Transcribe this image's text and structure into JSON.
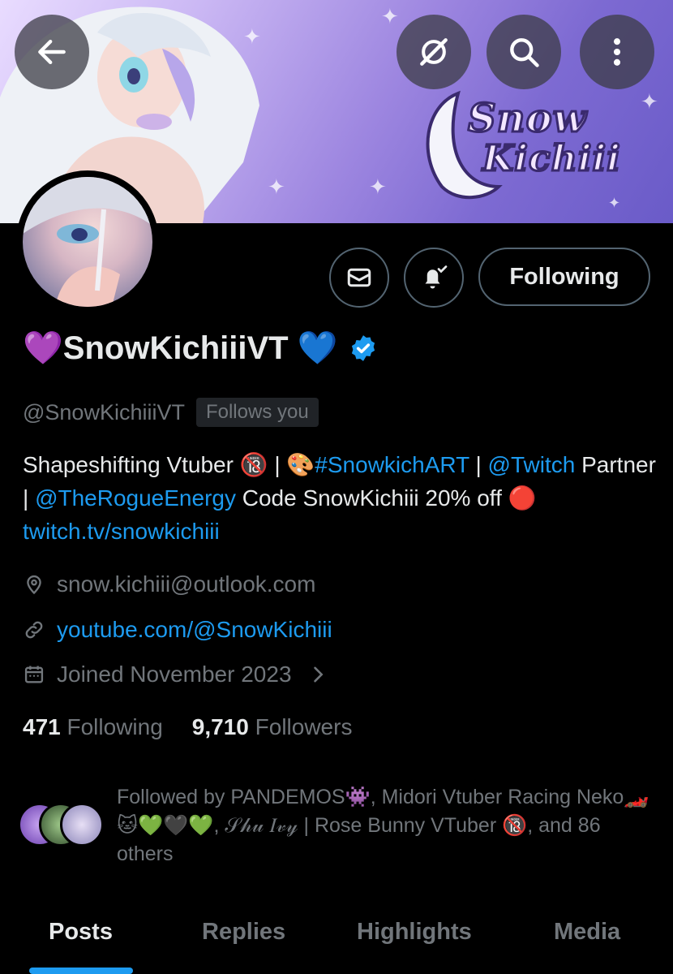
{
  "header": {
    "back_icon": "arrow-left-icon",
    "grok_icon": "grok-icon",
    "search_icon": "search-icon",
    "more_icon": "more-vertical-icon",
    "banner_brand_top": "Snow",
    "banner_brand_bottom": "Kichiii"
  },
  "profile": {
    "display_name": "💜SnowKichiiiVT 💙",
    "verified": true,
    "handle": "@SnowKichiiiVT",
    "follows_you": "Follows you",
    "actions": {
      "message_icon": "mail-icon",
      "notify_icon": "bell-check-icon",
      "follow_label": "Following"
    },
    "bio": {
      "part1": "Shapeshifting Vtuber 🔞 | 🎨",
      "hashtag": "#SnowkichART",
      "part2": " | ",
      "mention1": "@Twitch",
      "part3": " Partner | ",
      "mention2": "@TheRogueEnergy",
      "part4": " Code SnowKichiii  20% off 🔴 ",
      "link": "twitch.tv/snowkichiii"
    },
    "location": "snow.kichiii@outlook.com",
    "website": "youtube.com/@SnowKichiii",
    "joined": "Joined November 2023"
  },
  "stats": {
    "following_count": "471",
    "following_label": "Following",
    "followers_count": "9,710",
    "followers_label": "Followers"
  },
  "followed_by": {
    "text": "Followed by PANDEMOS👾, Midori Vtuber Racing Neko🏎️ 🐱💚🖤💚, 𝒮𝒽𝓊 𝐼𝓋𝓎 | Rose Bunny VTuber 🔞, and 86 others"
  },
  "tabs": [
    "Posts",
    "Replies",
    "Highlights",
    "Media"
  ],
  "colors": {
    "accent": "#1d9bf0",
    "muted": "#71767b",
    "text": "#e7e9ea",
    "background": "#000000"
  }
}
